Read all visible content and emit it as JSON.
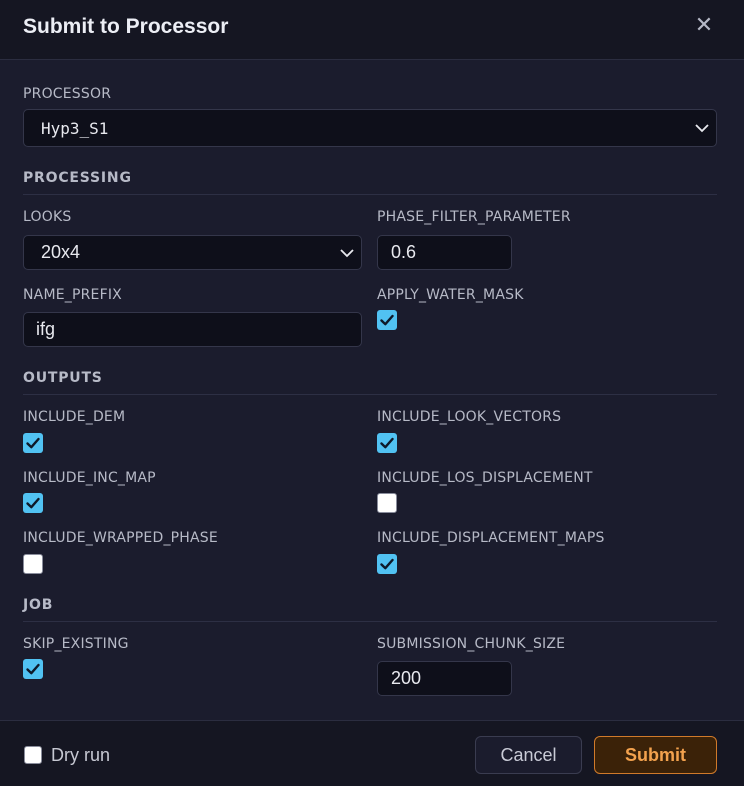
{
  "dialog": {
    "title": "Submit to Processor"
  },
  "processor": {
    "label": "PROCESSOR",
    "value": "Hyp3_S1"
  },
  "sections": {
    "processing": "PROCESSING",
    "outputs": "OUTPUTS",
    "job": "JOB"
  },
  "fields": {
    "looks": {
      "label": "LOOKS",
      "value": "20x4"
    },
    "phase_filter_parameter": {
      "label": "PHASE_FILTER_PARAMETER",
      "value": "0.6"
    },
    "name_prefix": {
      "label": "NAME_PREFIX",
      "value": "ifg"
    },
    "apply_water_mask": {
      "label": "APPLY_WATER_MASK",
      "checked": true
    },
    "include_dem": {
      "label": "INCLUDE_DEM",
      "checked": true
    },
    "include_look_vectors": {
      "label": "INCLUDE_LOOK_VECTORS",
      "checked": true
    },
    "include_inc_map": {
      "label": "INCLUDE_INC_MAP",
      "checked": true
    },
    "include_los_displacement": {
      "label": "INCLUDE_LOS_DISPLACEMENT",
      "checked": false
    },
    "include_wrapped_phase": {
      "label": "INCLUDE_WRAPPED_PHASE",
      "checked": false
    },
    "include_displacement_maps": {
      "label": "INCLUDE_DISPLACEMENT_MAPS",
      "checked": true
    },
    "skip_existing": {
      "label": "SKIP_EXISTING",
      "checked": true
    },
    "submission_chunk_size": {
      "label": "SUBMISSION_CHUNK_SIZE",
      "value": "200"
    }
  },
  "footer": {
    "dry_run_label": "Dry run",
    "dry_run_checked": false,
    "cancel_label": "Cancel",
    "submit_label": "Submit"
  },
  "colors": {
    "accent_check": "#51c2f2",
    "submit_border": "#d07a2a",
    "submit_text": "#f3a24e"
  },
  "icons": {
    "close": "close-icon",
    "chevron": "chevron-down-icon",
    "check": "checkmark-icon"
  }
}
